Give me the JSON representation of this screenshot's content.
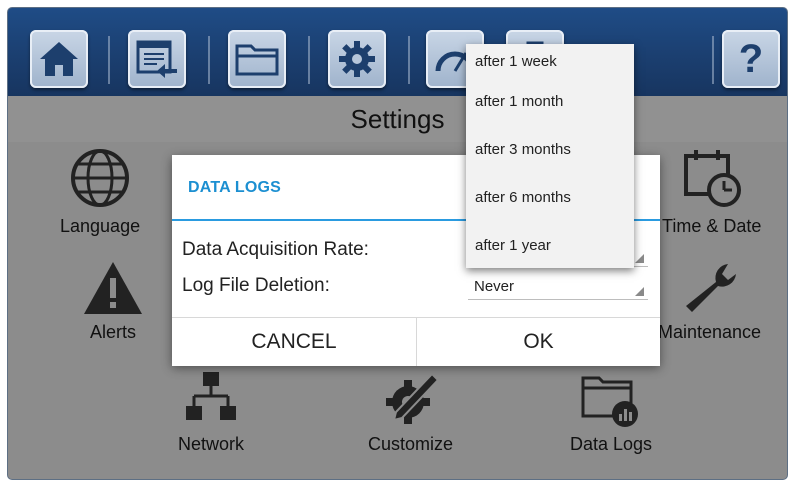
{
  "screen": {
    "title": "Settings"
  },
  "toolbar": {
    "buttons": [
      {
        "icon": "home-icon"
      },
      {
        "icon": "window-export-icon"
      },
      {
        "icon": "folder-icon"
      },
      {
        "icon": "gear-icon"
      },
      {
        "icon": "gauge-icon"
      },
      {
        "icon": "usb-icon"
      },
      {
        "icon": "help-icon"
      }
    ],
    "help_glyph": "?"
  },
  "settings_items": {
    "language": "Language",
    "time_date": "Time & Date",
    "alerts": "Alerts",
    "maintenance": "Maintenance",
    "network": "Network",
    "customize": "Customize",
    "data_logs": "Data Logs"
  },
  "dialog": {
    "title": "DATA LOGS",
    "rate_label": "Data Acquisition Rate:",
    "rate_value": "",
    "deletion_label": "Log File Deletion:",
    "deletion_value": "Never",
    "cancel_label": "CANCEL",
    "ok_label": "OK"
  },
  "dropdown": {
    "options": [
      "after 1 week",
      "after 1 month",
      "after 3 months",
      "after 6 months",
      "after 1 year"
    ]
  },
  "colors": {
    "toolbar": "#1b3f70",
    "background": "#8c8c8c",
    "dialog_accent": "#1c8fd1"
  }
}
